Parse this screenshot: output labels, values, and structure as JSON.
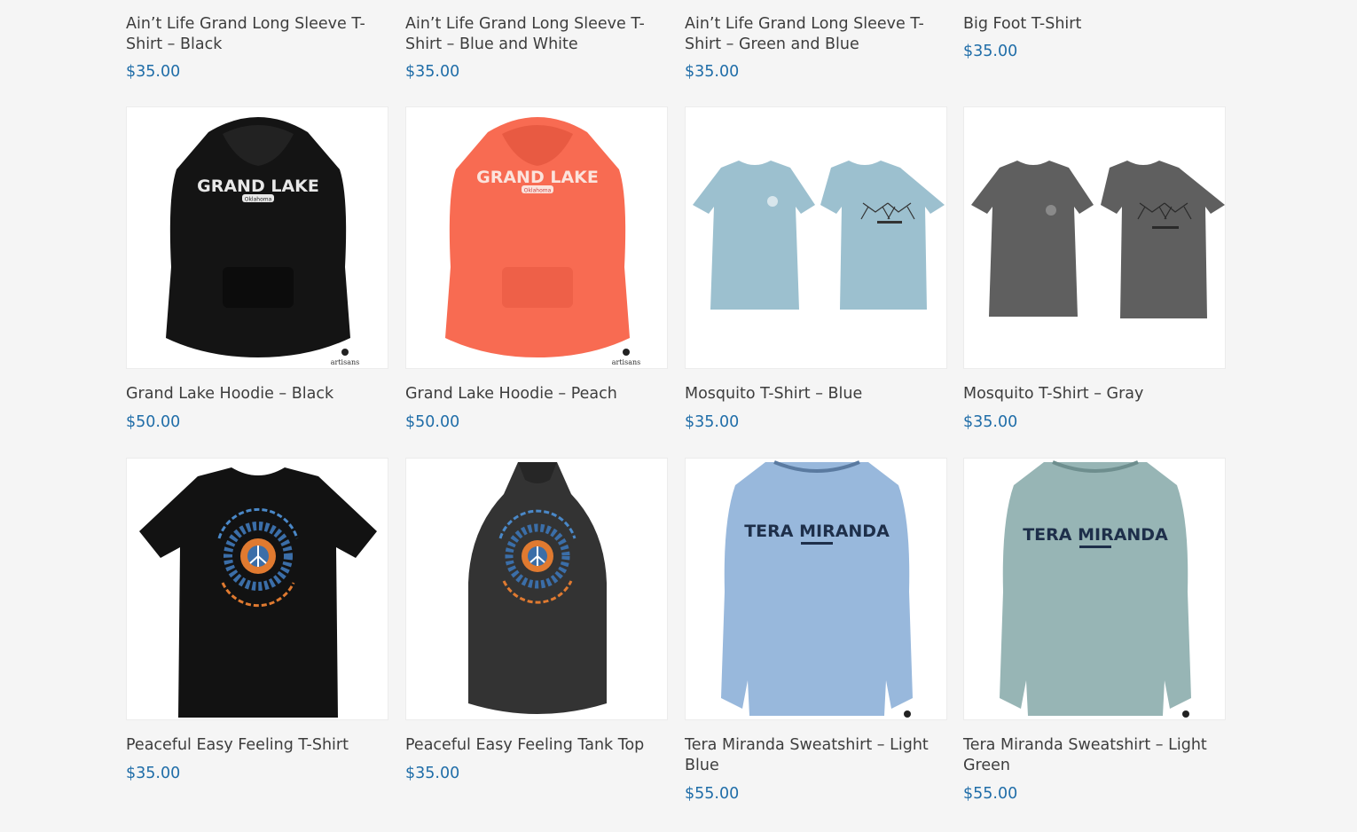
{
  "products": [
    {
      "title": "Ain’t Life Grand Long Sleeve T-Shirt – Black",
      "price": "$35.00"
    },
    {
      "title": "Ain’t Life Grand Long Sleeve T-Shirt – Blue and White",
      "price": "$35.00"
    },
    {
      "title": "Ain’t Life Grand Long Sleeve T-Shirt – Green and Blue",
      "price": "$35.00"
    },
    {
      "title": "Big Foot T-Shirt",
      "price": "$35.00"
    },
    {
      "title": "Grand Lake Hoodie – Black",
      "price": "$50.00",
      "image_text": "GRAND LAKE",
      "image_subtext": "Oklahoma",
      "brand": "artisans",
      "color": "#141414"
    },
    {
      "title": "Grand Lake Hoodie – Peach",
      "price": "$50.00",
      "image_text": "GRAND LAKE",
      "image_subtext": "Oklahoma",
      "brand": "artisans",
      "color": "#f86b52"
    },
    {
      "title": "Mosquito T-Shirt – Blue",
      "price": "$35.00",
      "color": "#9cc0cf"
    },
    {
      "title": "Mosquito T-Shirt – Gray",
      "price": "$35.00",
      "color": "#5f5f5f"
    },
    {
      "title": "Peaceful Easy Feeling T-Shirt",
      "price": "$35.00",
      "color": "#121212"
    },
    {
      "title": "Peaceful Easy Feeling Tank Top",
      "price": "$35.00",
      "color": "#333333"
    },
    {
      "title": "Tera Miranda Sweatshirt – Light Blue",
      "price": "$55.00",
      "image_text": "TERA MIRANDA",
      "color": "#98b8dc"
    },
    {
      "title": "Tera Miranda Sweatshirt – Light Green",
      "price": "$55.00",
      "image_text": "TERA MIRANDA",
      "color": "#97b5b5"
    }
  ],
  "colors": {
    "price": "#1f6da8",
    "title": "#3d3d3d",
    "background": "#f5f5f5"
  }
}
